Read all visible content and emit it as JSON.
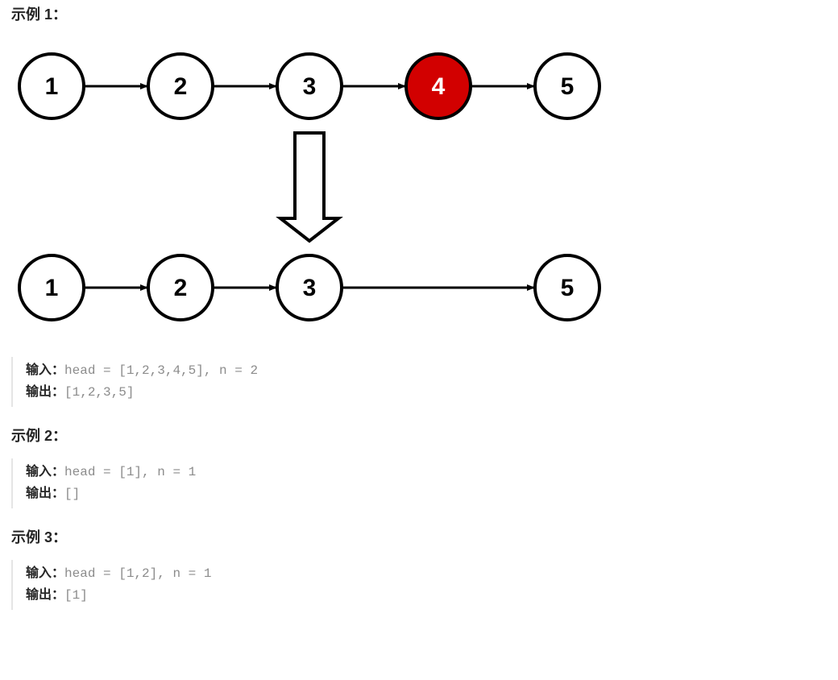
{
  "examples": [
    {
      "heading": "示例 1：",
      "input_label": "输入：",
      "input_value": "head = [1,2,3,4,5], n = 2",
      "output_label": "输出：",
      "output_value": "[1,2,3,5]"
    },
    {
      "heading": "示例 2：",
      "input_label": "输入：",
      "input_value": "head = [1], n = 1",
      "output_label": "输出：",
      "output_value": "[]"
    },
    {
      "heading": "示例 3：",
      "input_label": "输入：",
      "input_value": "head = [1,2], n = 1",
      "output_label": "输出：",
      "output_value": "[1]"
    }
  ],
  "diagram": {
    "top_nodes": [
      "1",
      "2",
      "3",
      "4",
      "5"
    ],
    "bottom_nodes": [
      "1",
      "2",
      "3",
      "5"
    ],
    "removed_index": 3,
    "highlight_color": "#d20000"
  }
}
